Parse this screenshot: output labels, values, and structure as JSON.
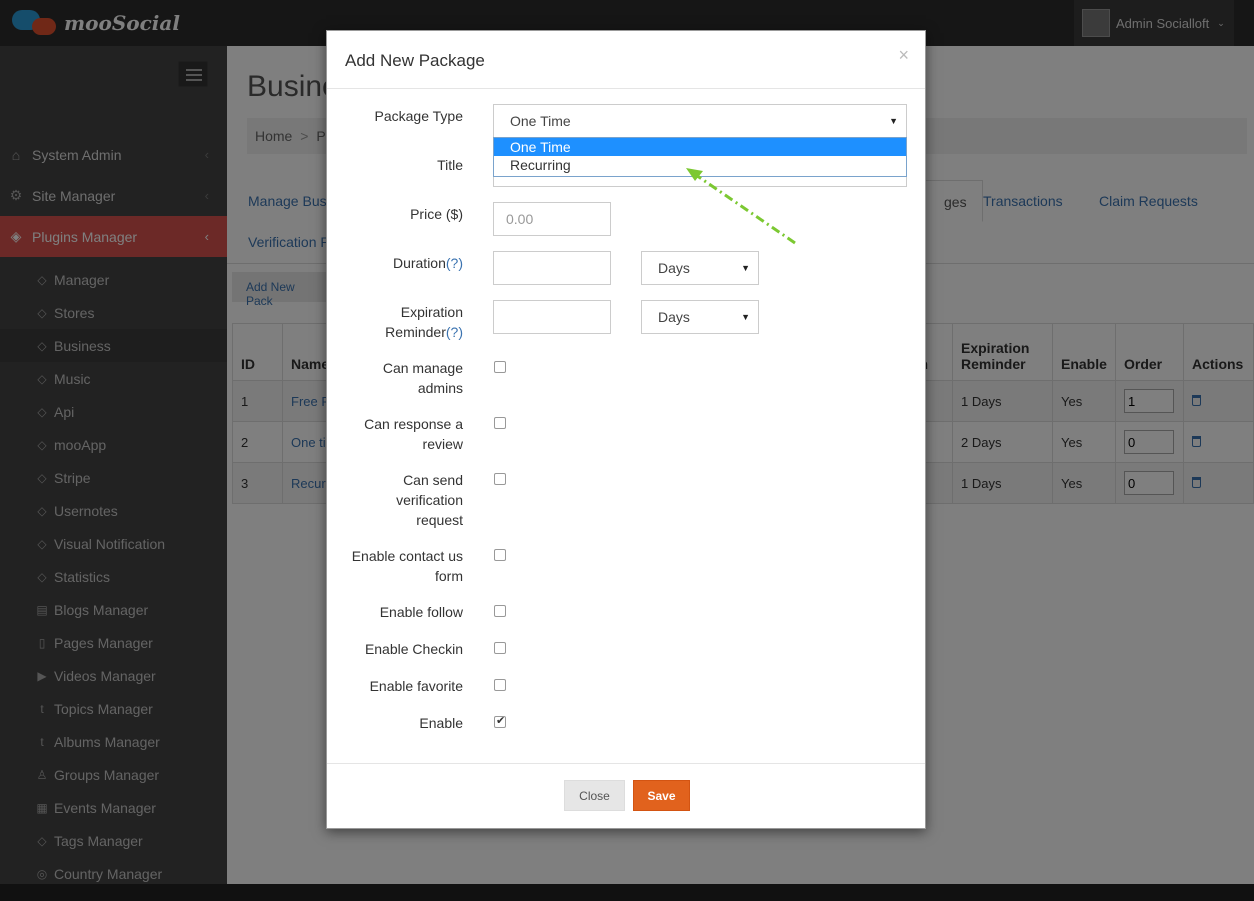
{
  "app": {
    "logo_text": "mooSocial",
    "user_name": "Admin Socialloft"
  },
  "sidebar": {
    "top_items": [
      {
        "label": "System Admin",
        "icon": "home-icon"
      },
      {
        "label": "Site Manager",
        "icon": "gears-icon"
      },
      {
        "label": "Plugins Manager",
        "icon": "tags-icon"
      }
    ],
    "sub_items": [
      {
        "label": "Manager",
        "icon": "tag-icon"
      },
      {
        "label": "Stores",
        "icon": "tag-icon"
      },
      {
        "label": "Business",
        "icon": "tag-icon"
      },
      {
        "label": "Music",
        "icon": "tag-icon"
      },
      {
        "label": "Api",
        "icon": "tag-icon"
      },
      {
        "label": "mooApp",
        "icon": "tag-icon"
      },
      {
        "label": "Stripe",
        "icon": "tag-icon"
      },
      {
        "label": "Usernotes",
        "icon": "tag-icon"
      },
      {
        "label": "Visual Notification",
        "icon": "tag-icon"
      },
      {
        "label": "Statistics",
        "icon": "tag-icon"
      },
      {
        "label": "Blogs Manager",
        "icon": "comment-icon"
      },
      {
        "label": "Pages Manager",
        "icon": "file-icon"
      },
      {
        "label": "Videos Manager",
        "icon": "video-icon"
      },
      {
        "label": "Topics Manager",
        "icon": "topic-icon"
      },
      {
        "label": "Albums Manager",
        "icon": "topic-icon"
      },
      {
        "label": "Groups Manager",
        "icon": "users-icon"
      },
      {
        "label": "Events Manager",
        "icon": "calendar-icon"
      },
      {
        "label": "Tags Manager",
        "icon": "tag-icon"
      },
      {
        "label": "Country Manager",
        "icon": "globe-icon"
      }
    ]
  },
  "background": {
    "page_title": "Busine",
    "breadcrumb_home": "Home",
    "breadcrumb_sep": ">",
    "breadcrumb_next": "Plu",
    "tabs": {
      "manage": "Manage Bus",
      "packages": "ges",
      "transactions": "Transactions",
      "claim_requests": "Claim Requests",
      "verification": "Verification R"
    },
    "add_button": "Add New Pack",
    "table": {
      "headers": {
        "id": "ID",
        "name": "Name",
        "col_cut": "on",
        "expiration_reminder": "Expiration Reminder",
        "enable": "Enable",
        "order": "Order",
        "actions": "Actions"
      },
      "rows": [
        {
          "id": "1",
          "name": "Free P",
          "col_cut": "r",
          "expiration_reminder": "1 Days",
          "enable": "Yes",
          "order": "1"
        },
        {
          "id": "2",
          "name": "One ti",
          "col_cut": "",
          "expiration_reminder": "2 Days",
          "enable": "Yes",
          "order": "0"
        },
        {
          "id": "3",
          "name": "Recur",
          "col_cut": "",
          "expiration_reminder": "1 Days",
          "enable": "Yes",
          "order": "0"
        }
      ]
    }
  },
  "modal": {
    "title": "Add New Package",
    "close_symbol": "×",
    "package_type": {
      "label": "Package Type",
      "value": "One Time",
      "options": [
        "One Time",
        "Recurring"
      ]
    },
    "title_label": "Title",
    "price": {
      "label": "Price ($)",
      "placeholder": "0.00"
    },
    "duration": {
      "label": "Duration",
      "help": "(?)",
      "unit": "Days"
    },
    "expiration_reminder": {
      "label_line1": "Expiration",
      "label_line2": "Reminder",
      "help": "(?)",
      "unit": "Days"
    },
    "checkboxes": [
      {
        "lines": [
          "Can manage",
          "admins"
        ],
        "checked": false
      },
      {
        "lines": [
          "Can response a",
          "review"
        ],
        "checked": false
      },
      {
        "lines": [
          "Can send",
          "verification",
          "request"
        ],
        "checked": false
      },
      {
        "lines": [
          "Enable contact us",
          "form"
        ],
        "checked": false
      },
      {
        "lines": [
          "Enable follow"
        ],
        "checked": false
      },
      {
        "lines": [
          "Enable Checkin"
        ],
        "checked": false
      },
      {
        "lines": [
          "Enable favorite"
        ],
        "checked": false
      },
      {
        "lines": [
          "Enable"
        ],
        "checked": true
      }
    ],
    "buttons": {
      "close": "Close",
      "save": "Save"
    }
  },
  "annotation": {
    "arrow_color": "#7cc832"
  },
  "colors": {
    "accent_red": "#d9534f",
    "save_orange": "#e1621d",
    "link_blue": "#3b73b0",
    "highlight_blue": "#1e90ff"
  }
}
